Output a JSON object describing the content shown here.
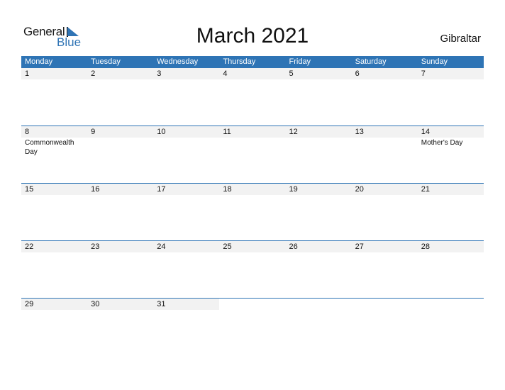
{
  "logo": {
    "line1": "General",
    "line2": "Blue"
  },
  "title": "March 2021",
  "country": "Gibraltar",
  "colors": {
    "accent": "#2e74b5",
    "date_strip": "#f2f2f2"
  },
  "weekdays": [
    "Monday",
    "Tuesday",
    "Wednesday",
    "Thursday",
    "Friday",
    "Saturday",
    "Sunday"
  ],
  "weeks": [
    [
      {
        "d": "1",
        "e": ""
      },
      {
        "d": "2",
        "e": ""
      },
      {
        "d": "3",
        "e": ""
      },
      {
        "d": "4",
        "e": ""
      },
      {
        "d": "5",
        "e": ""
      },
      {
        "d": "6",
        "e": ""
      },
      {
        "d": "7",
        "e": ""
      }
    ],
    [
      {
        "d": "8",
        "e": "Commonwealth Day"
      },
      {
        "d": "9",
        "e": ""
      },
      {
        "d": "10",
        "e": ""
      },
      {
        "d": "11",
        "e": ""
      },
      {
        "d": "12",
        "e": ""
      },
      {
        "d": "13",
        "e": ""
      },
      {
        "d": "14",
        "e": "Mother's Day"
      }
    ],
    [
      {
        "d": "15",
        "e": ""
      },
      {
        "d": "16",
        "e": ""
      },
      {
        "d": "17",
        "e": ""
      },
      {
        "d": "18",
        "e": ""
      },
      {
        "d": "19",
        "e": ""
      },
      {
        "d": "20",
        "e": ""
      },
      {
        "d": "21",
        "e": ""
      }
    ],
    [
      {
        "d": "22",
        "e": ""
      },
      {
        "d": "23",
        "e": ""
      },
      {
        "d": "24",
        "e": ""
      },
      {
        "d": "25",
        "e": ""
      },
      {
        "d": "26",
        "e": ""
      },
      {
        "d": "27",
        "e": ""
      },
      {
        "d": "28",
        "e": ""
      }
    ],
    [
      {
        "d": "29",
        "e": ""
      },
      {
        "d": "30",
        "e": ""
      },
      {
        "d": "31",
        "e": ""
      }
    ]
  ]
}
